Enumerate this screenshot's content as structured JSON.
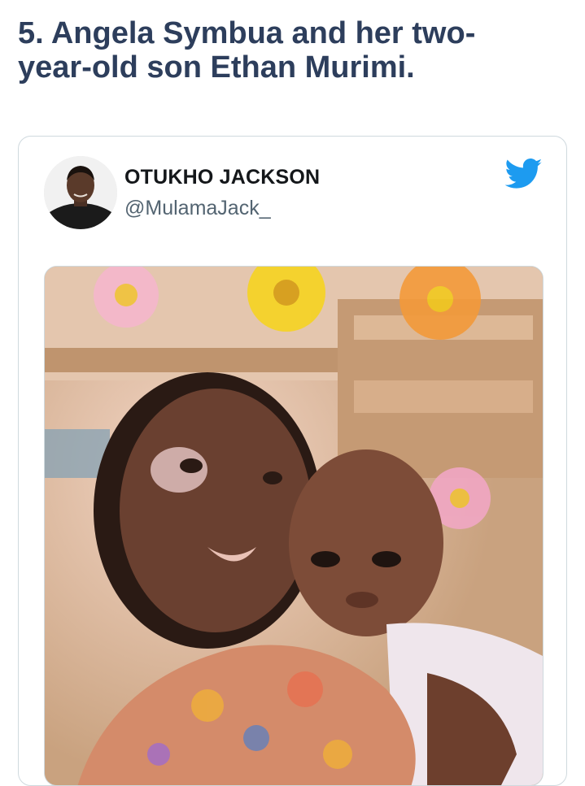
{
  "article": {
    "headline": "5. Angela Symbua and her two-year-old son Ethan Murimi."
  },
  "tweet": {
    "author_name": "OTUKHO JACKSON",
    "author_handle": "@MulamaJack_",
    "brand_icon": "twitter-bird-icon",
    "colors": {
      "headline": "#2d3e5c",
      "twitter_blue": "#1d9bf0",
      "handle": "#536471",
      "card_border": "#cfd9de"
    }
  }
}
